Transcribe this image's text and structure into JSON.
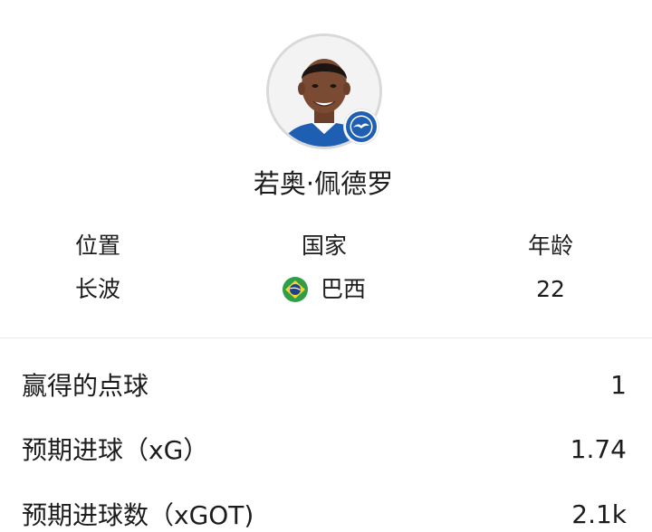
{
  "player": {
    "name": "若奥·佩德罗",
    "photo_icon": "player-portrait",
    "club_badge_icon": "club-crest"
  },
  "info": [
    {
      "label": "位置",
      "value": "长波"
    },
    {
      "label": "国家",
      "value": "巴西",
      "flag_icon": "brazil-flag"
    },
    {
      "label": "年龄",
      "value": "22"
    }
  ],
  "stats": [
    {
      "label": "赢得的点球",
      "value": "1"
    },
    {
      "label": "预期进球（xG）",
      "value": "1.74"
    },
    {
      "label": "预期进球数（xGOT)",
      "value": "2.1k"
    }
  ],
  "colors": {
    "divider": "#e8e8e8",
    "avatar_border": "#d9d9d9",
    "club_blue": "#1f5fb3",
    "flag_green": "#2e9e48",
    "flag_yellow": "#f5d331",
    "flag_blue": "#1f3f8f"
  }
}
